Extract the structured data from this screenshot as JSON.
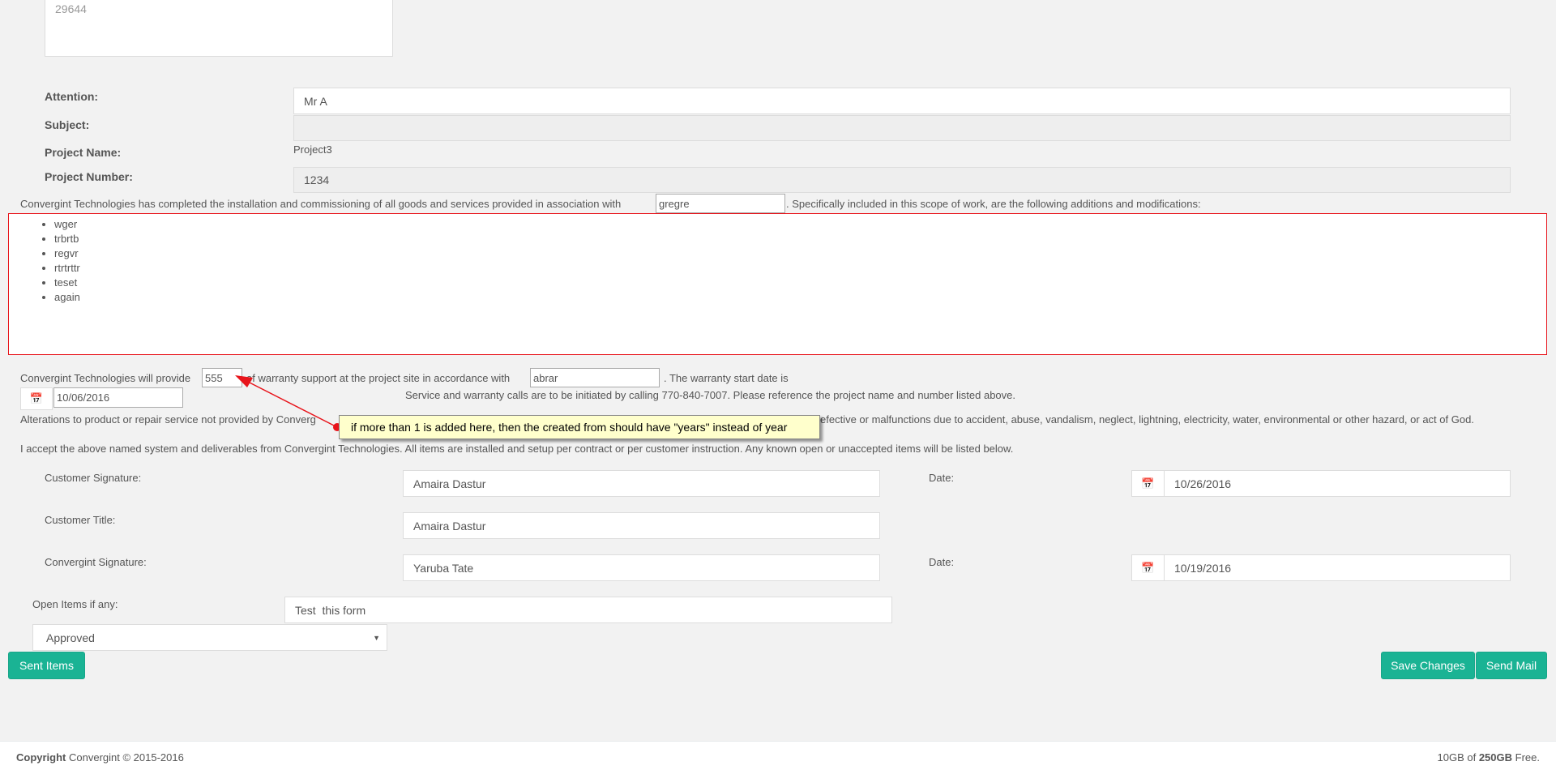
{
  "address_textarea": "29644",
  "form": {
    "attention_label": "Attention:",
    "attention_value": "Mr A",
    "subject_label": "Subject:",
    "subject_value": "",
    "project_name_label": "Project Name:",
    "project_name_value": "Project3",
    "project_number_label": "Project Number:",
    "project_number_value": "1234"
  },
  "scope": {
    "text_before": "Convergint Technologies has completed the installation and commissioning of all goods and services provided in association with",
    "association_value": "gregre",
    "text_after": ". Specifically included in this scope of work, are the following additions and modifications:",
    "items": [
      "wger",
      "trbrtb",
      "regvr",
      "rtrtrttr",
      "teset",
      "again"
    ]
  },
  "warranty": {
    "text1": "Convergint Technologies will provide",
    "years_value": "555",
    "text2": "of warranty support at the project site in accordance with",
    "accordance_value": "abrar",
    "text3": ". The warranty start date is",
    "start_date": "10/06/2016",
    "service_text": "Service and warranty calls are to be initiated by calling 770-840-7007. Please reference the project name and number listed above.",
    "alterations_start": "Alterations to product or repair service not provided by Converg",
    "alterations_end": "efective or malfunctions due to accident, abuse, vandalism, neglect, lightning, electricity, water, environmental or other hazard, or act of God.",
    "accept_text": "I accept the above named system and deliverables from Convergint Technologies. All items are installed and setup per contract or per customer instruction. Any known open or unaccepted items will be listed below."
  },
  "annotation": "if more than 1 is added here, then the created from should have \"years\" instead of year",
  "signatures": {
    "customer_sig_label": "Customer Signature:",
    "customer_sig_value": "Amaira Dastur",
    "date_label": "Date:",
    "customer_date": "10/26/2016",
    "customer_title_label": "Customer Title:",
    "customer_title_value": "Amaira Dastur",
    "convergint_sig_label": "Convergint Signature:",
    "convergint_sig_value": "Yaruba Tate",
    "convergint_date": "10/19/2016"
  },
  "open_items": {
    "label": "Open Items if any:",
    "value": "Test  this form",
    "status": "Approved"
  },
  "buttons": {
    "sent_items": "Sent Items",
    "save_changes": "Save Changes",
    "send_mail": "Send Mail"
  },
  "footer": {
    "copyright": "Copyright",
    "company": "Convergint © 2015-2016",
    "storage_used": "10GB of ",
    "storage_total": "250GB",
    "storage_suffix": " Free."
  },
  "colors": {
    "accent": "#1ab394",
    "highlight_border": "#e8141b",
    "tooltip_bg": "#ffffcc"
  }
}
